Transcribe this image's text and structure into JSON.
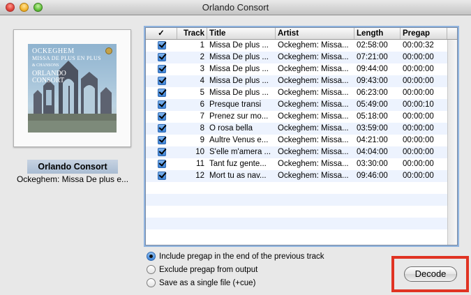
{
  "window": {
    "title": "Orlando Consort"
  },
  "album": {
    "art_lines": [
      "OCKEGHEM",
      "MISSA DE PLUS EN PLUS",
      "& CHANSONS",
      "ORLANDO",
      "CONSORT"
    ],
    "artist": "Orlando Consort",
    "subtitle": "Ockeghem: Missa De plus e..."
  },
  "table": {
    "headers": {
      "check": "✓",
      "track": "Track",
      "title": "Title",
      "artist": "Artist",
      "length": "Length",
      "pregap": "Pregap"
    },
    "rows": [
      {
        "checked": true,
        "track": "1",
        "title": "Missa De plus ...",
        "artist": "Ockeghem: Missa...",
        "length": "02:58:00",
        "pregap": "00:00:32"
      },
      {
        "checked": true,
        "track": "2",
        "title": "Missa De plus ...",
        "artist": "Ockeghem: Missa...",
        "length": "07:21:00",
        "pregap": "00:00:00"
      },
      {
        "checked": true,
        "track": "3",
        "title": "Missa De plus ...",
        "artist": "Ockeghem: Missa...",
        "length": "09:44:00",
        "pregap": "00:00:00"
      },
      {
        "checked": true,
        "track": "4",
        "title": "Missa De plus ...",
        "artist": "Ockeghem: Missa...",
        "length": "09:43:00",
        "pregap": "00:00:00"
      },
      {
        "checked": true,
        "track": "5",
        "title": "Missa De plus ...",
        "artist": "Ockeghem: Missa...",
        "length": "06:23:00",
        "pregap": "00:00:00"
      },
      {
        "checked": true,
        "track": "6",
        "title": "Presque transi",
        "artist": "Ockeghem: Missa...",
        "length": "05:49:00",
        "pregap": "00:00:10"
      },
      {
        "checked": true,
        "track": "7",
        "title": "Prenez sur mo...",
        "artist": "Ockeghem: Missa...",
        "length": "05:18:00",
        "pregap": "00:00:00"
      },
      {
        "checked": true,
        "track": "8",
        "title": "O rosa bella",
        "artist": "Ockeghem: Missa...",
        "length": "03:59:00",
        "pregap": "00:00:00"
      },
      {
        "checked": true,
        "track": "9",
        "title": "Aultre Venus e...",
        "artist": "Ockeghem: Missa...",
        "length": "04:21:00",
        "pregap": "00:00:00"
      },
      {
        "checked": true,
        "track": "10",
        "title": "S'elle m'amera ...",
        "artist": "Ockeghem: Missa...",
        "length": "04:04:00",
        "pregap": "00:00:00"
      },
      {
        "checked": true,
        "track": "11",
        "title": "Tant fuz gente...",
        "artist": "Ockeghem: Missa...",
        "length": "03:30:00",
        "pregap": "00:00:00"
      },
      {
        "checked": true,
        "track": "12",
        "title": "Mort tu as nav...",
        "artist": "Ockeghem: Missa...",
        "length": "09:46:00",
        "pregap": "00:00:00"
      }
    ]
  },
  "options": [
    {
      "label": "Include pregap in the end of the previous track",
      "selected": true
    },
    {
      "label": "Exclude pregap from output",
      "selected": false
    },
    {
      "label": "Save as a single file (+cue)",
      "selected": false
    }
  ],
  "actions": {
    "decode_label": "Decode"
  },
  "colors": {
    "highlight": "#e03323",
    "selection_blue": "#3d83d6"
  }
}
